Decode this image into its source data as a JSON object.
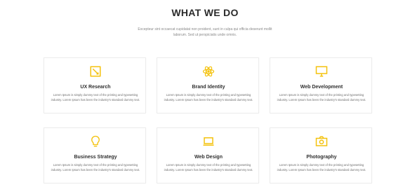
{
  "section": {
    "title": "WHAT WE DO",
    "subtitle": "Excepteur sint occaecat cupidatat non proident, sunt in culpa qui officia deserunt mollit laborum. Sed ut perspiciatis unde omnis."
  },
  "accent_color": "#f4c20d",
  "services": [
    {
      "title": "UX Research",
      "icon": "crop-icon",
      "text": "Lorem Ipsum is simply dummy text of the printing and typesetting industry. Lorem Ipsum has been the industry's standard dummy text."
    },
    {
      "title": "Brand Identity",
      "icon": "atom-icon",
      "text": "Lorem Ipsum is simply dummy text of the printing and typesetting industry. Lorem Ipsum has been the industry's standard dummy text."
    },
    {
      "title": "Web Development",
      "icon": "monitor-icon",
      "text": "Lorem Ipsum is simply dummy text of the printing and typesetting industry. Lorem Ipsum has been the industry's standard dummy text."
    },
    {
      "title": "Business Strategy",
      "icon": "lightbulb-icon",
      "text": "Lorem Ipsum is simply dummy text of the printing and typesetting industry. Lorem Ipsum has been the industry's standard dummy text."
    },
    {
      "title": "Web Design",
      "icon": "laptop-icon",
      "text": "Lorem Ipsum is simply dummy text of the printing and typesetting industry. Lorem Ipsum has been the industry's standard dummy text."
    },
    {
      "title": "Photography",
      "icon": "camera-icon",
      "text": "Lorem Ipsum is simply dummy text of the printing and typesetting industry. Lorem Ipsum has been the industry's standard dummy text."
    }
  ]
}
